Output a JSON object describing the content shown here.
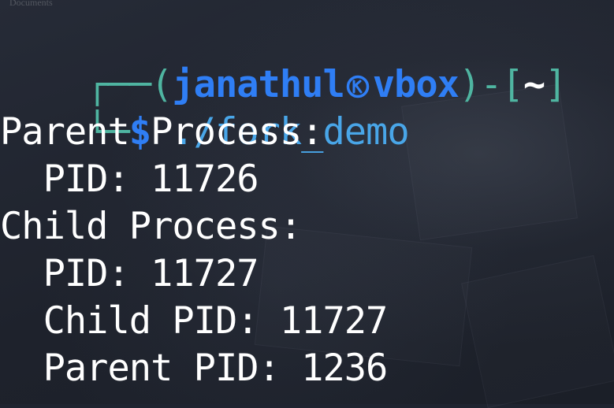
{
  "background_label": "Documents",
  "prompt": {
    "open_paren": "┌──(",
    "user": "janathul",
    "host": "vbox",
    "close_bracket": ")-[",
    "directory": "~",
    "end_bracket": "]",
    "corner": "└─",
    "dollar": "$",
    "command": "./fork_demo"
  },
  "output": {
    "parent_heading": "Parent Process:",
    "parent_pid": "  PID: 11726",
    "child_heading": "Child Process:",
    "child_pid": "  PID: 11727",
    "child_child_pid": "  Child PID: 11727",
    "child_parent_pid": "  Parent PID: 1236"
  },
  "colors": {
    "background": "#1f2430",
    "prompt_frame": "#4fb5a1",
    "user_host": "#2f7ef5",
    "command": "#49a6e8",
    "text": "#ffffff"
  },
  "icons": {
    "separator": "kali-logo-icon"
  }
}
